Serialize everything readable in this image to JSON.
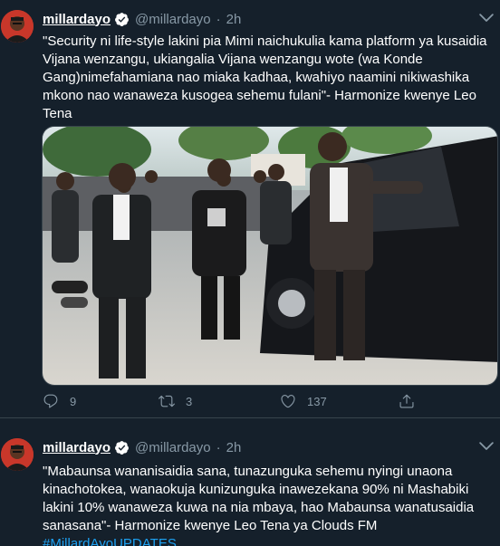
{
  "tweets": [
    {
      "name": "millardayo",
      "handle": "@millardayo",
      "time": "2h",
      "separator": "·",
      "text": "\"Security ni life-style lakini pia Mimi naichukulia kama platform ya kusaidia Vijana wenzangu, ukiangalia Vijana wenzangu wote (wa Konde Gang)nimefahamiana nao miaka kadhaa, kwahiyo naamini nikiwashika mkono nao wanaweza kusogea sehemu fulani\"- Harmonize kwenye Leo Tena",
      "replies": "9",
      "retweets": "3",
      "likes": "137",
      "icons": [
        "reply-icon",
        "retweet-icon",
        "like-icon",
        "share-icon"
      ]
    },
    {
      "name": "millardayo",
      "handle": "@millardayo",
      "time": "2h",
      "separator": "·",
      "text": "\"Mabaunsa wananisaidia sana, tunazunguka sehemu nyingi unaona kinachotokea, wanaokuja kunizunguka inawezekana 90% ni Mashabiki lakini 10% wanaweza kuwa na nia mbaya, hao Mabaunsa wanatusaidia sanasana\"- Harmonize kwenye Leo Tena ya Clouds FM",
      "hashtag": "#MillardAyoUPDATES"
    }
  ],
  "colors": {
    "background": "#15202b",
    "text": "#ffffff",
    "secondary": "#8899a6",
    "accent": "#1da1f2",
    "divider": "#38444d"
  }
}
